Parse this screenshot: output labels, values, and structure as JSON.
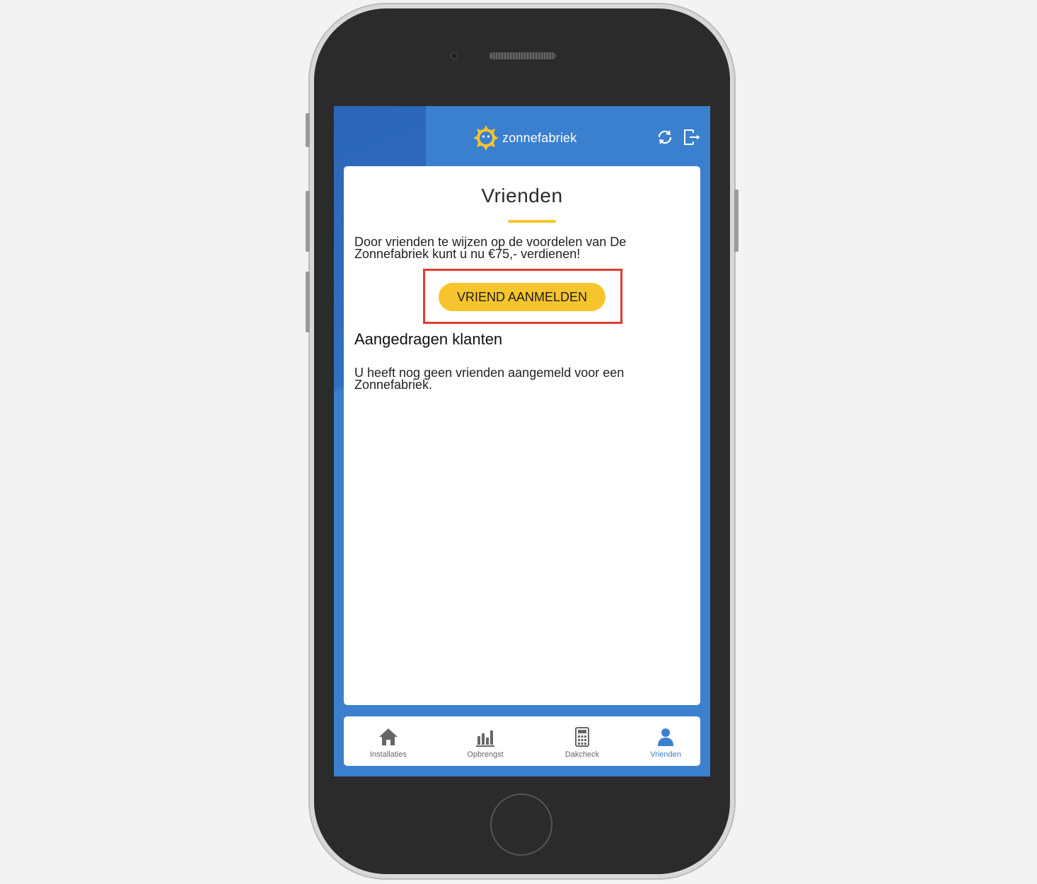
{
  "app": {
    "brand": "zonnefabriek",
    "colors": {
      "primary": "#3b7fcf",
      "accent": "#f6c52d",
      "highlight": "#e23b2e"
    }
  },
  "header": {
    "logo_icon": "sun-logo-icon",
    "actions": [
      {
        "name": "refresh-icon"
      },
      {
        "name": "logout-icon"
      }
    ]
  },
  "main": {
    "title": "Vrienden",
    "intro": "Door vrienden te wijzen op de voordelen van De Zonnefabriek kunt u nu €75,- verdienen!",
    "cta_label": "VRIEND AANMELDEN",
    "section_title": "Aangedragen klanten",
    "empty_text": "U heeft nog geen vrienden aangemeld voor een Zonnefabriek."
  },
  "tabbar": {
    "tabs": [
      {
        "label": "Installaties",
        "icon": "home-icon",
        "active": false
      },
      {
        "label": "Opbrengst",
        "icon": "bar-chart-icon",
        "active": false
      },
      {
        "label": "Dakcheck",
        "icon": "calculator-icon",
        "active": false
      },
      {
        "label": "Vrienden",
        "icon": "user-icon",
        "active": true
      }
    ]
  }
}
